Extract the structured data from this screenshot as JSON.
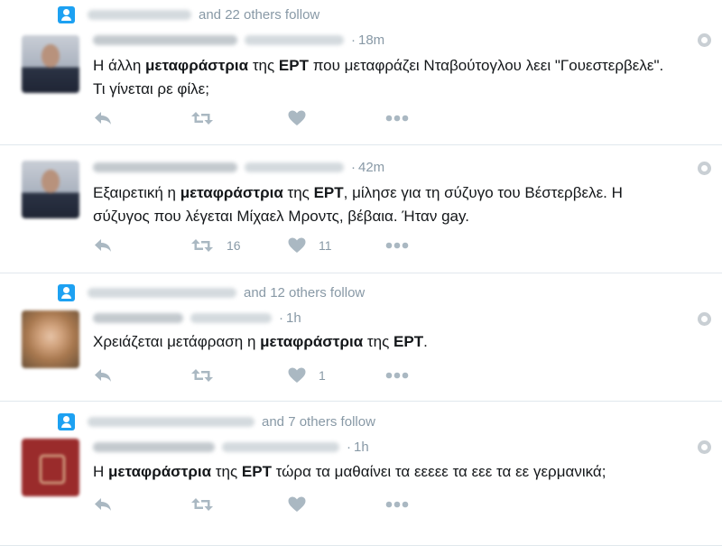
{
  "tweets": [
    {
      "context": "and 22 others follow",
      "time": "18m",
      "text_segments": [
        {
          "t": "Η άλλη ",
          "b": false
        },
        {
          "t": "μεταφράστρια",
          "b": true
        },
        {
          "t": " της ",
          "b": false
        },
        {
          "t": "ΕΡΤ",
          "b": true
        },
        {
          "t": " που μεταφράζει Νταβούτογλου λεει \"Γουεστερβελε\". Τι γίνεται ρε φίλε;",
          "b": false
        }
      ],
      "retweets": "",
      "likes": ""
    },
    {
      "context": "",
      "time": "42m",
      "text_segments": [
        {
          "t": "Εξαιρετική η ",
          "b": false
        },
        {
          "t": "μεταφράστρια",
          "b": true
        },
        {
          "t": " της ",
          "b": false
        },
        {
          "t": "ΕΡΤ",
          "b": true
        },
        {
          "t": ", μίλησε για τη σύζυγο του Βέστερβελε. Η σύζυγος που λέγεται Μίχαελ Μροντς, βέβαια. Ήταν gay.",
          "b": false
        }
      ],
      "retweets": "16",
      "likes": "11"
    },
    {
      "context": "and 12 others follow",
      "time": "1h",
      "text_segments": [
        {
          "t": "Χρειάζεται μετάφραση η ",
          "b": false
        },
        {
          "t": "μεταφράστρια",
          "b": true
        },
        {
          "t": " της ",
          "b": false
        },
        {
          "t": "ΕΡΤ",
          "b": true
        },
        {
          "t": ".",
          "b": false
        }
      ],
      "retweets": "",
      "likes": "1"
    },
    {
      "context": "and 7 others follow",
      "time": "1h",
      "text_segments": [
        {
          "t": "Η ",
          "b": false
        },
        {
          "t": "μεταφράστρια",
          "b": true
        },
        {
          "t": " της ",
          "b": false
        },
        {
          "t": "ΕΡΤ",
          "b": true
        },
        {
          "t": " τώρα τα μαθαίνει τα εεεεε τα εεε τα εε γερμανικά;",
          "b": false
        }
      ],
      "retweets": "",
      "likes": ""
    }
  ],
  "icons": {
    "follow": "person-follow-icon",
    "reply": "reply-icon",
    "retweet": "retweet-icon",
    "like": "heart-icon",
    "more": "more-icon",
    "globe": "globe-icon"
  },
  "colors": {
    "accent": "#1da1f2",
    "muted": "#8899a6",
    "icon": "#aab8c2",
    "text": "#14171a",
    "divider": "#e1e8ed"
  }
}
